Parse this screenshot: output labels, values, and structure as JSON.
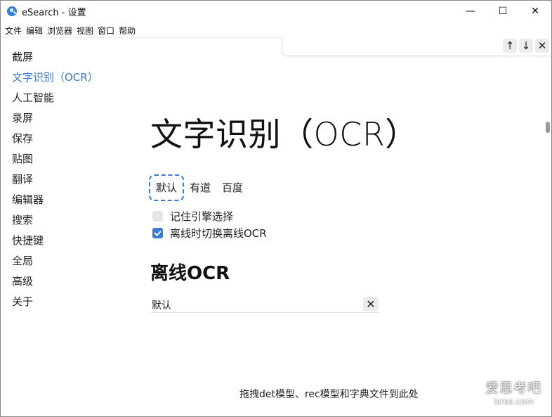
{
  "window": {
    "title": "eSearch - 设置",
    "controls": {
      "minimize": "—",
      "maximize": "☐",
      "close": "✕"
    }
  },
  "menubar": [
    "文件",
    "编辑",
    "浏览器",
    "视图",
    "窗口",
    "帮助"
  ],
  "findbar": {
    "up": "↑",
    "down": "↓",
    "close": "✕"
  },
  "sidebar": {
    "items": [
      "截屏",
      "文字识别（OCR）",
      "人工智能",
      "录屏",
      "保存",
      "贴图",
      "翻译",
      "编辑器",
      "搜索",
      "快捷键",
      "全局",
      "高级",
      "关于"
    ],
    "active_index": 1
  },
  "main": {
    "title": "文字识别（OCR）",
    "engine_tabs": [
      "默认",
      "有道",
      "百度"
    ],
    "selected_engine": "默认",
    "options": [
      {
        "label": "记住引擎选择",
        "checked": false
      },
      {
        "label": "离线时切换离线OCR",
        "checked": true
      }
    ],
    "offline_section_title": "离线OCR",
    "model_entry": "默认",
    "drop_hint": "拖拽det模型、rec模型和字典文件到此处"
  },
  "watermark": {
    "line1": "爱思考吧",
    "line2": "isres.com"
  },
  "colors": {
    "accent": "#3a7bd5",
    "app_icon": "#2f7de1"
  }
}
